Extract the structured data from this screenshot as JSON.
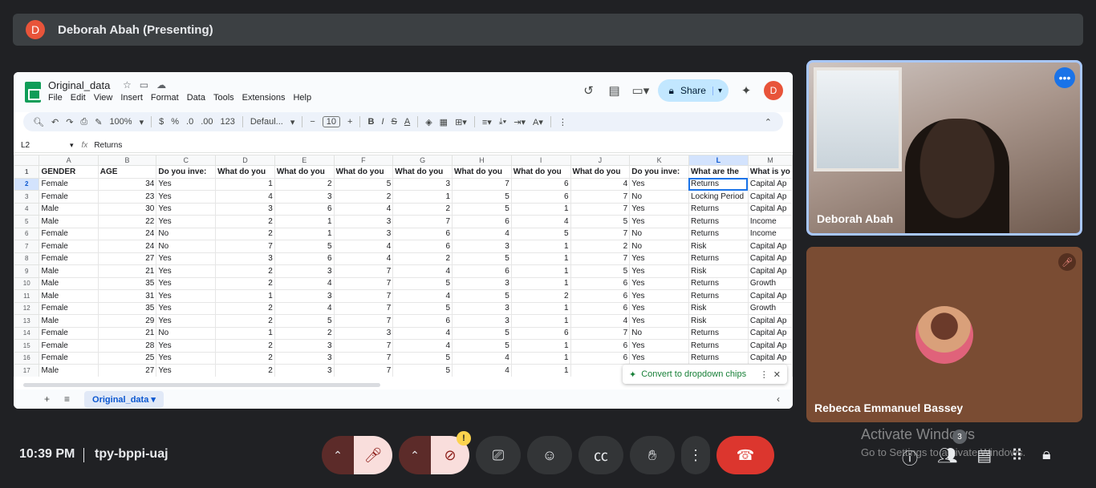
{
  "presenter": {
    "initial": "D",
    "label": "Deborah Abah (Presenting)"
  },
  "sheet": {
    "title": "Original_data",
    "menu": [
      "File",
      "Edit",
      "View",
      "Insert",
      "Format",
      "Data",
      "Tools",
      "Extensions",
      "Help"
    ],
    "share_label": "Share",
    "user_initial": "D",
    "zoom": "100%",
    "currency": "$",
    "percent": "%",
    "dec_less": ".0",
    "dec_more": ".00",
    "num_format": "123",
    "font": "Defaul...",
    "font_size": "10",
    "cell_ref": "L2",
    "formula": "Returns",
    "columns": [
      "A",
      "B",
      "C",
      "D",
      "E",
      "F",
      "G",
      "H",
      "I",
      "J",
      "K",
      "L",
      "M"
    ],
    "header_row": [
      "GENDER",
      "AGE",
      "Do you inve:",
      "What do you",
      "What do you",
      "What do you",
      "What do you",
      "What do you",
      "What do you",
      "What do you",
      "Do you inve:",
      "What are the",
      "What is yo"
    ],
    "rows": [
      [
        "Female",
        "34",
        "Yes",
        "1",
        "2",
        "5",
        "3",
        "7",
        "6",
        "4",
        "Yes",
        "Returns",
        "Capital Ap"
      ],
      [
        "Female",
        "23",
        "Yes",
        "4",
        "3",
        "2",
        "1",
        "5",
        "6",
        "7",
        "No",
        "Locking Period",
        "Capital Ap"
      ],
      [
        "Male",
        "30",
        "Yes",
        "3",
        "6",
        "4",
        "2",
        "5",
        "1",
        "7",
        "Yes",
        "Returns",
        "Capital Ap"
      ],
      [
        "Male",
        "22",
        "Yes",
        "2",
        "1",
        "3",
        "7",
        "6",
        "4",
        "5",
        "Yes",
        "Returns",
        "Income"
      ],
      [
        "Female",
        "24",
        "No",
        "2",
        "1",
        "3",
        "6",
        "4",
        "5",
        "7",
        "No",
        "Returns",
        "Income"
      ],
      [
        "Female",
        "24",
        "No",
        "7",
        "5",
        "4",
        "6",
        "3",
        "1",
        "2",
        "No",
        "Risk",
        "Capital Ap"
      ],
      [
        "Female",
        "27",
        "Yes",
        "3",
        "6",
        "4",
        "2",
        "5",
        "1",
        "7",
        "Yes",
        "Returns",
        "Capital Ap"
      ],
      [
        "Male",
        "21",
        "Yes",
        "2",
        "3",
        "7",
        "4",
        "6",
        "1",
        "5",
        "Yes",
        "Risk",
        "Capital Ap"
      ],
      [
        "Male",
        "35",
        "Yes",
        "2",
        "4",
        "7",
        "5",
        "3",
        "1",
        "6",
        "Yes",
        "Returns",
        "Growth"
      ],
      [
        "Male",
        "31",
        "Yes",
        "1",
        "3",
        "7",
        "4",
        "5",
        "2",
        "6",
        "Yes",
        "Returns",
        "Capital Ap"
      ],
      [
        "Female",
        "35",
        "Yes",
        "2",
        "4",
        "7",
        "5",
        "3",
        "1",
        "6",
        "Yes",
        "Risk",
        "Growth"
      ],
      [
        "Male",
        "29",
        "Yes",
        "2",
        "5",
        "7",
        "6",
        "3",
        "1",
        "4",
        "Yes",
        "Risk",
        "Capital Ap"
      ],
      [
        "Female",
        "21",
        "No",
        "1",
        "2",
        "3",
        "4",
        "5",
        "6",
        "7",
        "No",
        "Returns",
        "Capital Ap"
      ],
      [
        "Female",
        "28",
        "Yes",
        "2",
        "3",
        "7",
        "4",
        "5",
        "1",
        "6",
        "Yes",
        "Returns",
        "Capital Ap"
      ],
      [
        "Female",
        "25",
        "Yes",
        "2",
        "3",
        "7",
        "5",
        "4",
        "1",
        "6",
        "Yes",
        "Returns",
        "Capital Ap"
      ],
      [
        "Male",
        "27",
        "Yes",
        "2",
        "3",
        "7",
        "5",
        "4",
        "1",
        "",
        "",
        "",
        ""
      ]
    ],
    "chip_popup": "Convert to dropdown chips",
    "tab_name": "Original_data"
  },
  "participants": [
    {
      "name": "Deborah Abah"
    },
    {
      "name": "Rebecca Emmanuel Bassey"
    }
  ],
  "bottom": {
    "time": "10:39 PM",
    "meeting_code": "tpy-bppi-uaj",
    "people_count": "3",
    "warning": "!"
  },
  "watermark": {
    "line1": "Activate Windows",
    "line2": "Go to Settings to activate Windows."
  },
  "colors": {
    "end_call": "#dc362e",
    "share": "#c2e7ff",
    "accent": "#1a73e8"
  }
}
